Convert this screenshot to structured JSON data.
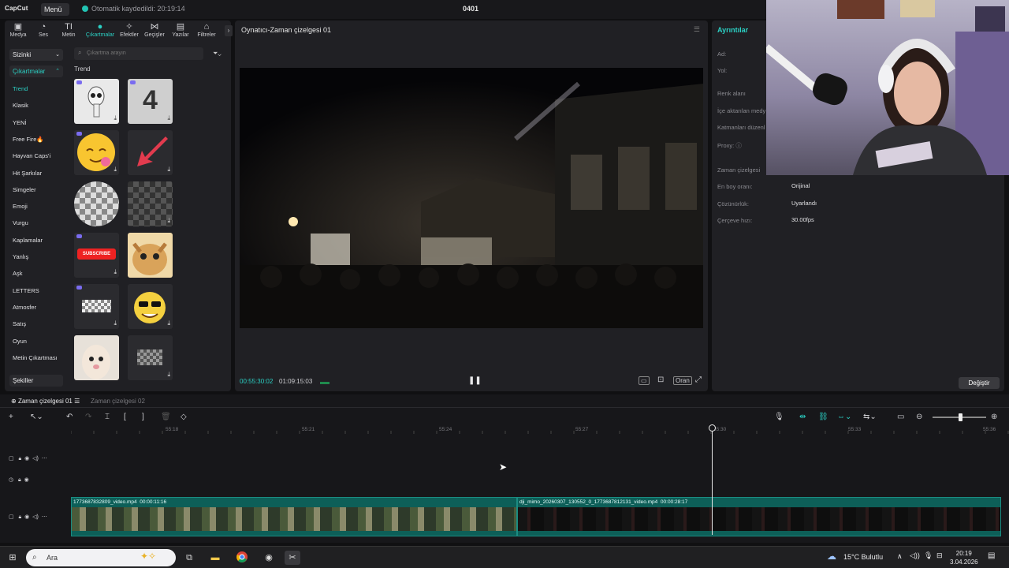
{
  "app": {
    "logo": "CapCut",
    "menu_label": "Menü",
    "autosave": "Otomatik kaydedildi: 20:19:14",
    "project_title": "0401"
  },
  "toolbar": {
    "items": [
      "Medya",
      "Ses",
      "Metin",
      "Çıkartmalar",
      "Efektler",
      "Geçişler",
      "Yazılar",
      "Filtreler"
    ],
    "icons": [
      "media-icon",
      "audio-icon",
      "text-icon",
      "sticker-icon",
      "effects-icon",
      "transitions-icon",
      "captions-icon",
      "filters-icon"
    ]
  },
  "sidebar": {
    "mine": "Sizinki",
    "stickers": "Çıkartmalar",
    "categories": [
      "Trend",
      "Klasik",
      "YENİ",
      "Free Fire🔥",
      "Hayvan Caps'i",
      "Hit Şarkılar",
      "Simgeler",
      "Emoji",
      "Vurgu",
      "Kaplamalar",
      "Yanlış",
      "Aşk",
      "LETTERS",
      "Atmosfer",
      "Satış",
      "Oyun",
      "Metin Çıkartması"
    ],
    "shapes": "Şekiller"
  },
  "stickers_panel": {
    "search_placeholder": "Çıkartma arayın",
    "section": "Trend",
    "subscribe": "SUBSCRIBE"
  },
  "preview": {
    "title": "Oynatıcı-Zaman çizelgesi 01",
    "current_time": "00:55:30:02",
    "total_time": "01:09:15:03",
    "ratio_btn": "Oran"
  },
  "details": {
    "title": "Ayrıntılar",
    "labels": [
      "Ad:",
      "Yol:",
      "Renk alanı",
      "İçe aktarılan medy",
      "Katmanları düzenl",
      "Proxy:",
      "Zaman çizelgesi",
      "En boy oranı:",
      "Çözünürlük:",
      "Çerçeve hızı:"
    ],
    "aspect": "Orijinal",
    "resolution": "Uyarlandı",
    "fps": "30.00fps",
    "change_btn": "Değiştir"
  },
  "timeline": {
    "tab1": "Zaman çizelgesi 01",
    "tab2": "Zaman çizelgesi 02",
    "ruler": [
      "55:18",
      "55:21",
      "55:24",
      "55:27",
      "55:30",
      "55:33",
      "55:36"
    ],
    "clip1": {
      "name": "1773687832809_video.mp4",
      "duration": "00:00:11:16"
    },
    "clip2": {
      "name": "dji_mimo_20260307_130552_0_1773687812131_video.mp4",
      "duration": "00:00:28:17"
    }
  },
  "taskbar": {
    "search": "Ara",
    "weather": "15°C  Bulutlu",
    "time": "20:19",
    "date": "3.04.2026"
  }
}
